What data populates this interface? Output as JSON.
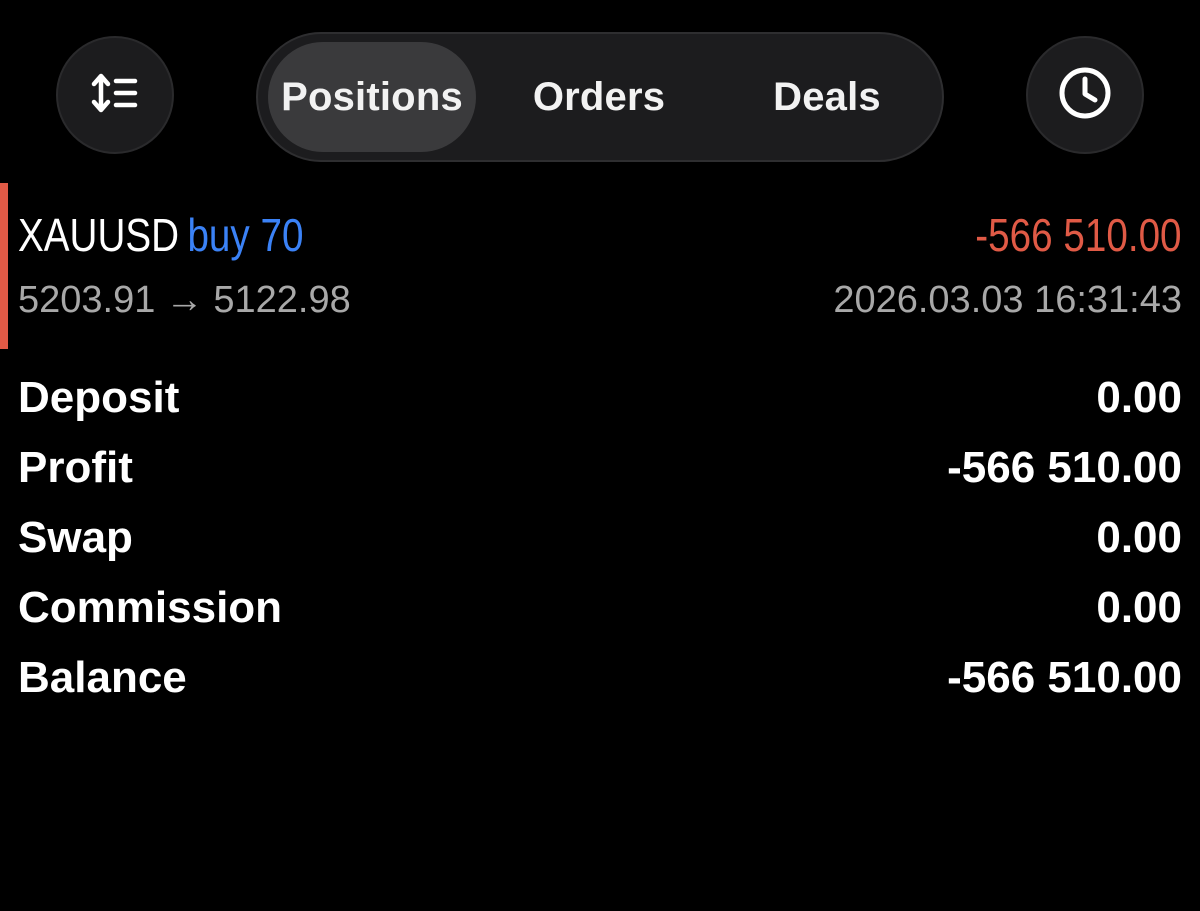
{
  "header": {
    "tabs": [
      {
        "label": "Positions",
        "selected": true
      },
      {
        "label": "Orders",
        "selected": false
      },
      {
        "label": "Deals",
        "selected": false
      }
    ],
    "left_button_icon": "sort-icon",
    "right_button_icon": "clock-icon"
  },
  "position": {
    "symbol": "XAUUSD",
    "side": "buy 70",
    "profit": "-566 510.00",
    "open_price": "5203.91",
    "arrow": "→",
    "current_price": "5122.98",
    "time": "2026.03.03 16:31:43"
  },
  "summary": [
    {
      "label": "Deposit",
      "value": "0.00"
    },
    {
      "label": "Profit",
      "value": "-566 510.00"
    },
    {
      "label": "Swap",
      "value": "0.00"
    },
    {
      "label": "Commission",
      "value": "0.00"
    },
    {
      "label": "Balance",
      "value": "-566 510.00"
    }
  ],
  "colors": {
    "loss": "#e05a46",
    "buy": "#3b82f6",
    "secondary_text": "#a8a8a8",
    "background": "#000000"
  }
}
